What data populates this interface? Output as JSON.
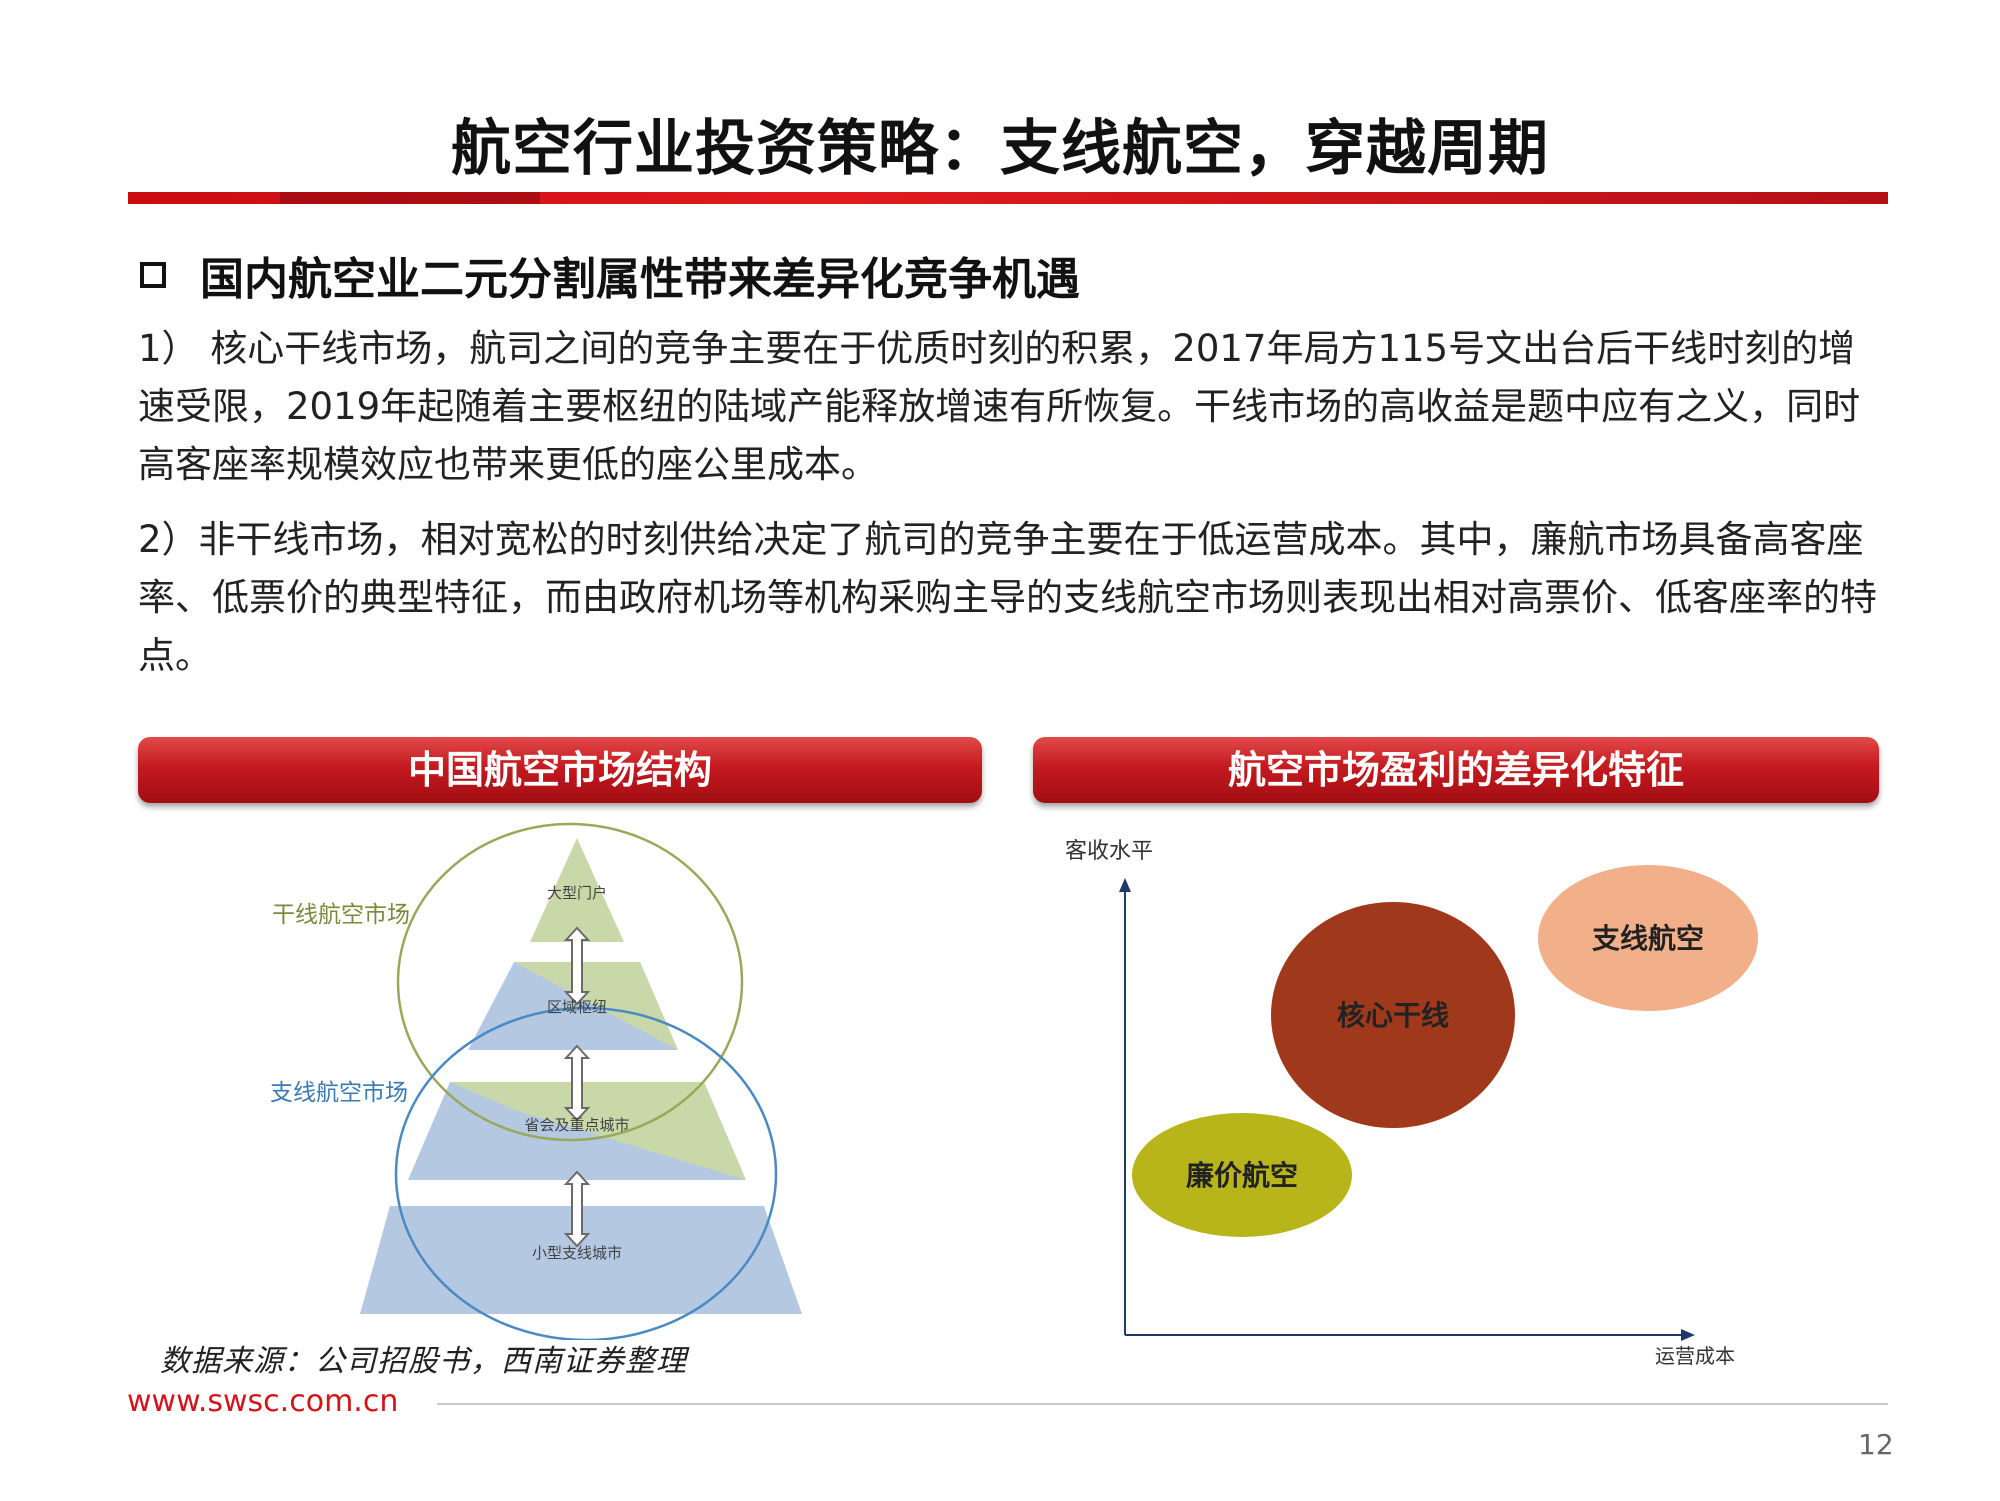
{
  "title": "航空行业投资策略：支线航空，穿越周期",
  "section": {
    "heading": "国内航空业二元分割属性带来差异化竞争机遇",
    "p1": "1） 核心干线市场，航司之间的竞争主要在于优质时刻的积累，2017年局方115号文出台后干线时刻的增速受限，2019年起随着主要枢纽的陆域产能释放增速有所恢复。干线市场的高收益是题中应有之义，同时高客座率规模效应也带来更低的座公里成本。",
    "p2": "2）非干线市场，相对宽松的时刻供给决定了航司的竞争主要在于低运营成本。其中，廉航市场具备高客座率、低票价的典型特征，而由政府机场等机构采购主导的支线航空市场则表现出相对高票价、低客座率的特点。"
  },
  "left_panel": {
    "header": "中国航空市场结构",
    "trunk_label": "干线航空市场",
    "regional_label": "支线航空市场",
    "tiers": [
      "大型门户",
      "区域枢纽",
      "省会及重点城市",
      "小型支线城市"
    ],
    "colors": {
      "olive": "#c9d8a8",
      "blue": "#b4c8e2",
      "olive_line": "#9aa85a",
      "blue_line": "#4a8ac4"
    }
  },
  "right_panel": {
    "header": "航空市场盈利的差异化特征",
    "y_label": "客收水平",
    "x_label": "运营成本",
    "bubbles": [
      {
        "label": "廉价航空",
        "color": "#b7b51a"
      },
      {
        "label": "核心干线",
        "color": "#a0391c"
      },
      {
        "label": "支线航空",
        "color": "#f2b08a"
      }
    ]
  },
  "footer": {
    "source": "数据来源：公司招股书，西南证券整理",
    "site": "www.swsc.com.cn",
    "page": "12"
  }
}
